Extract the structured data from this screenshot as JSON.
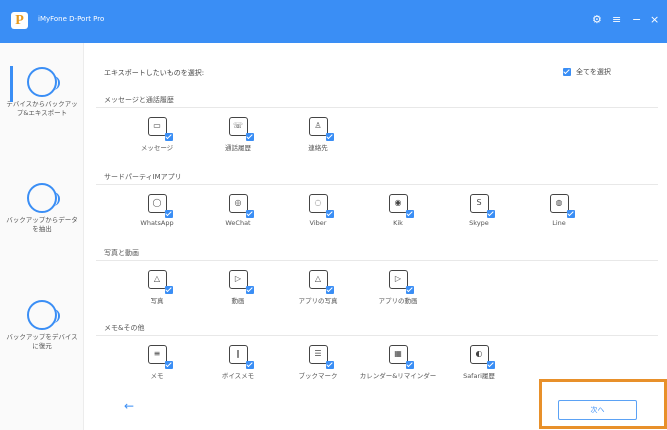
{
  "app": {
    "title": "iMyFone D-Port Pro",
    "logo_letter": "P"
  },
  "window_controls": [
    {
      "name": "settings-icon",
      "glyph": "⚙"
    },
    {
      "name": "menu-icon",
      "glyph": "≡"
    },
    {
      "name": "minimize-icon",
      "glyph": "−"
    },
    {
      "name": "close-icon",
      "glyph": "×"
    }
  ],
  "sidebar": {
    "items": [
      {
        "label": "デバイスからバックアップ&エキスポート"
      },
      {
        "label": "バックアップからデータを抽出"
      },
      {
        "label": "バックアップをデバイスに復元"
      }
    ]
  },
  "main": {
    "prompt": "エキスポートしたいものを選択:",
    "select_all": "全てを選択",
    "sections": [
      {
        "title": "メッセージと通話履歴",
        "items": [
          {
            "label": "メッセージ",
            "icon": "message-icon"
          },
          {
            "label": "通話履歴",
            "icon": "call-history-icon"
          },
          {
            "label": "連絡先",
            "icon": "contacts-icon"
          }
        ]
      },
      {
        "title": "サードパーティIMアプリ",
        "items": [
          {
            "label": "WhatsApp",
            "icon": "whatsapp-icon"
          },
          {
            "label": "WeChat",
            "icon": "wechat-icon"
          },
          {
            "label": "Viber",
            "icon": "viber-icon"
          },
          {
            "label": "Kik",
            "icon": "kik-icon"
          },
          {
            "label": "Skype",
            "icon": "skype-icon"
          },
          {
            "label": "Line",
            "icon": "line-icon"
          }
        ]
      },
      {
        "title": "写真と動画",
        "items": [
          {
            "label": "写真",
            "icon": "photo-icon"
          },
          {
            "label": "動画",
            "icon": "video-icon"
          },
          {
            "label": "アプリの写真",
            "icon": "app-photo-icon"
          },
          {
            "label": "アプリの動画",
            "icon": "app-video-icon"
          }
        ]
      },
      {
        "title": "メモ&その他",
        "items": [
          {
            "label": "メモ",
            "icon": "notes-icon"
          },
          {
            "label": "ボイスメモ",
            "icon": "voice-memo-icon"
          },
          {
            "label": "ブックマーク",
            "icon": "bookmark-icon"
          },
          {
            "label": "カレンダー&リマインダー",
            "icon": "calendar-icon"
          },
          {
            "label": "Safari履歴",
            "icon": "safari-history-icon"
          }
        ]
      }
    ]
  },
  "footer": {
    "back_glyph": "←",
    "next_label": "次へ"
  },
  "colors": {
    "accent": "#3a8ef5",
    "highlight": "#e8902a"
  }
}
